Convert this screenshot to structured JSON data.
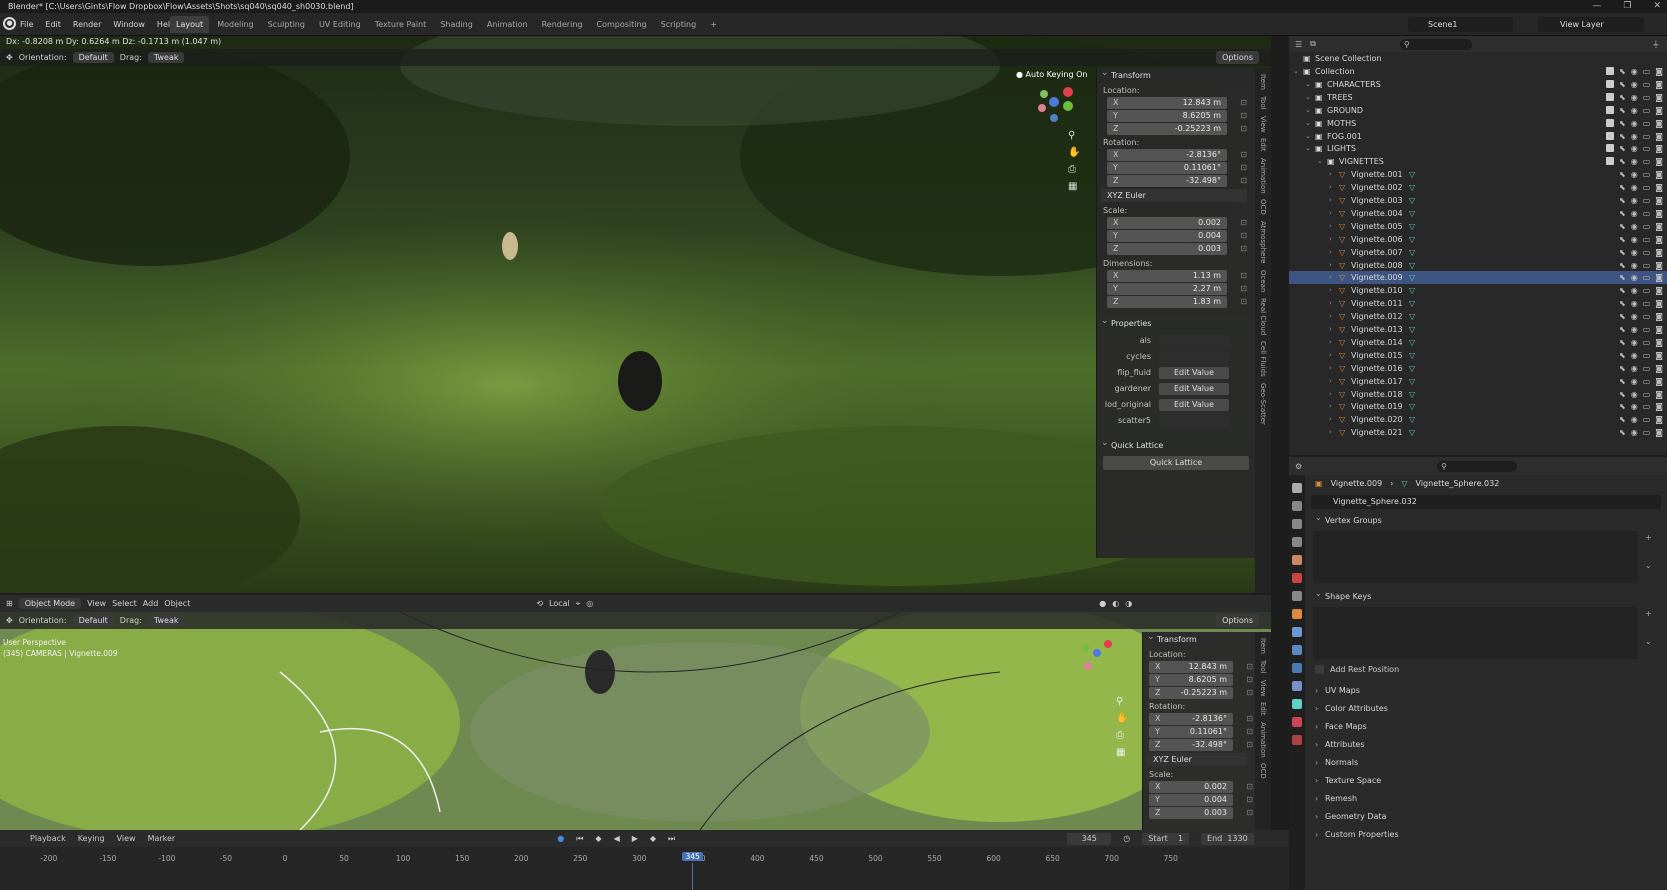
{
  "title_bar": {
    "title": "Blender* [C:\\Users\\Gints\\Flow Dropbox\\Flow\\Assets\\Shots\\sq040\\sq040_sh0030.blend]",
    "controls": [
      "—",
      "❐",
      "✕"
    ]
  },
  "menu": [
    "File",
    "Edit",
    "Render",
    "Window",
    "Help"
  ],
  "workspaces": [
    "Layout",
    "Modeling",
    "Sculpting",
    "UV Editing",
    "Texture Paint",
    "Shading",
    "Animation",
    "Rendering",
    "Compositing",
    "Scripting",
    "+"
  ],
  "active_workspace": "Layout",
  "scene": "Scene1",
  "view_layer": "View Layer",
  "status_text": "Dx: -0.8208 m   Dy: 0.6264 m   Dz: -0.1713 m (1.047 m)",
  "viewport_top": {
    "orientation_label": "Orientation:",
    "orientation_value": "Default",
    "drag_label": "Drag:",
    "drag_value": "Tweak",
    "options": "Options",
    "auto_keying": "Auto Keying On"
  },
  "npanel": {
    "transform": "Transform",
    "location_label": "Location:",
    "location": [
      {
        "ax": "X",
        "v": "12.843 m"
      },
      {
        "ax": "Y",
        "v": "8.6205 m"
      },
      {
        "ax": "Z",
        "v": "-0.25223 m"
      }
    ],
    "rotation_label": "Rotation:",
    "rotation": [
      {
        "ax": "X",
        "v": "-2.8136°"
      },
      {
        "ax": "Y",
        "v": "0.11061°"
      },
      {
        "ax": "Z",
        "v": "-32.498°"
      }
    ],
    "rotation_mode": "XYZ Euler",
    "scale_label": "Scale:",
    "scale": [
      {
        "ax": "X",
        "v": "0.002"
      },
      {
        "ax": "Y",
        "v": "0.004"
      },
      {
        "ax": "Z",
        "v": "0.003"
      }
    ],
    "dimensions_label": "Dimensions:",
    "dimensions": [
      {
        "ax": "X",
        "v": "1.13 m"
      },
      {
        "ax": "Y",
        "v": "2.27 m"
      },
      {
        "ax": "Z",
        "v": "1.83 m"
      }
    ],
    "properties": "Properties",
    "props": [
      {
        "k": "als",
        "v": ""
      },
      {
        "k": "cycles",
        "v": ""
      },
      {
        "k": "flip_fluid",
        "v": "Edit Value"
      },
      {
        "k": "gardener",
        "v": "Edit Value"
      },
      {
        "k": "lod_original",
        "v": "Edit Value"
      },
      {
        "k": "scatter5",
        "v": ""
      }
    ],
    "quick_lattice": "Quick Lattice",
    "quick_lattice_btn": "Quick Lattice"
  },
  "side_tabs_top": [
    "Item",
    "Tool",
    "View",
    "Edit",
    "Animation",
    "OCD",
    "Atmosphere",
    "Ocean",
    "Real Cloud",
    "Cell Fluids",
    "Geo-Scatter"
  ],
  "side_tabs_bottom": [
    "Item",
    "Tool",
    "View",
    "Edit",
    "Animation",
    "OCD"
  ],
  "viewport_bottom": {
    "mode": "Object Mode",
    "menus": [
      "View",
      "Select",
      "Add",
      "Object"
    ],
    "pivot": "Local",
    "orientation_label": "Orientation:",
    "orientation_value": "Default",
    "drag_label": "Drag:",
    "drag_value": "Tweak",
    "options": "Options",
    "info_line1": "User Perspective",
    "info_line2": "(345) CAMERAS | Vignette.009"
  },
  "npanel2": {
    "transform": "Transform",
    "location_label": "Location:",
    "location": [
      {
        "ax": "X",
        "v": "12.843 m"
      },
      {
        "ax": "Y",
        "v": "8.6205 m"
      },
      {
        "ax": "Z",
        "v": "-0.25223 m"
      }
    ],
    "rotation_label": "Rotation:",
    "rotation": [
      {
        "ax": "X",
        "v": "-2.8136°"
      },
      {
        "ax": "Y",
        "v": "0.11061°"
      },
      {
        "ax": "Z",
        "v": "-32.498°"
      }
    ],
    "rotation_mode": "XYZ Euler",
    "scale_label": "Scale:",
    "scale": [
      {
        "ax": "X",
        "v": "0.002"
      },
      {
        "ax": "Y",
        "v": "0.004"
      },
      {
        "ax": "Z",
        "v": "0.003"
      }
    ]
  },
  "outliner": {
    "root": "Scene Collection",
    "rows": [
      {
        "name": "Collection",
        "level": 0,
        "type": "coll"
      },
      {
        "name": "CHARACTERS",
        "level": 1,
        "type": "coll"
      },
      {
        "name": "TREES",
        "level": 1,
        "type": "coll"
      },
      {
        "name": "GROUND",
        "level": 1,
        "type": "coll"
      },
      {
        "name": "MOTHS",
        "level": 1,
        "type": "coll"
      },
      {
        "name": "FOG.001",
        "level": 1,
        "type": "coll"
      },
      {
        "name": "LIGHTS",
        "level": 1,
        "type": "coll"
      },
      {
        "name": "VIGNETTES",
        "level": 2,
        "type": "coll"
      },
      {
        "name": "Vignette.001",
        "level": 3,
        "type": "obj"
      },
      {
        "name": "Vignette.002",
        "level": 3,
        "type": "obj"
      },
      {
        "name": "Vignette.003",
        "level": 3,
        "type": "obj"
      },
      {
        "name": "Vignette.004",
        "level": 3,
        "type": "obj"
      },
      {
        "name": "Vignette.005",
        "level": 3,
        "type": "obj"
      },
      {
        "name": "Vignette.006",
        "level": 3,
        "type": "obj"
      },
      {
        "name": "Vignette.007",
        "level": 3,
        "type": "obj"
      },
      {
        "name": "Vignette.008",
        "level": 3,
        "type": "obj"
      },
      {
        "name": "Vignette.009",
        "level": 3,
        "type": "obj",
        "selected": true
      },
      {
        "name": "Vignette.010",
        "level": 3,
        "type": "obj"
      },
      {
        "name": "Vignette.011",
        "level": 3,
        "type": "obj"
      },
      {
        "name": "Vignette.012",
        "level": 3,
        "type": "obj"
      },
      {
        "name": "Vignette.013",
        "level": 3,
        "type": "obj"
      },
      {
        "name": "Vignette.014",
        "level": 3,
        "type": "obj"
      },
      {
        "name": "Vignette.015",
        "level": 3,
        "type": "obj"
      },
      {
        "name": "Vignette.016",
        "level": 3,
        "type": "obj"
      },
      {
        "name": "Vignette.017",
        "level": 3,
        "type": "obj"
      },
      {
        "name": "Vignette.018",
        "level": 3,
        "type": "obj"
      },
      {
        "name": "Vignette.019",
        "level": 3,
        "type": "obj"
      },
      {
        "name": "Vignette.020",
        "level": 3,
        "type": "obj"
      },
      {
        "name": "Vignette.021",
        "level": 3,
        "type": "obj"
      }
    ]
  },
  "properties_editor": {
    "breadcrumb_object": "Vignette.009",
    "breadcrumb_data": "Vignette_Sphere.032",
    "mesh_name": "Vignette_Sphere.032",
    "sections": [
      "Vertex Groups",
      "Shape Keys",
      "UV Maps",
      "Color Attributes",
      "Face Maps",
      "Attributes",
      "Normals",
      "Texture Space",
      "Remesh",
      "Geometry Data",
      "Custom Properties"
    ],
    "add_rest_position": "Add Rest Position"
  },
  "timeline": {
    "menus": [
      "Playback",
      "Keying",
      "View",
      "Marker"
    ],
    "current_frame": "345",
    "start_label": "Start",
    "start": "1",
    "end_label": "End",
    "end": "1330",
    "ticks": [
      "-200",
      "-150",
      "-100",
      "-50",
      "0",
      "50",
      "100",
      "150",
      "200",
      "250",
      "300",
      "350",
      "400",
      "450",
      "500",
      "550",
      "600",
      "650",
      "700",
      "750"
    ]
  },
  "colors": {
    "accent": "#4772b3",
    "selected_row": "#3e5583",
    "object_icon": "#e08a3c",
    "mesh_icon": "#5fd1c3"
  }
}
